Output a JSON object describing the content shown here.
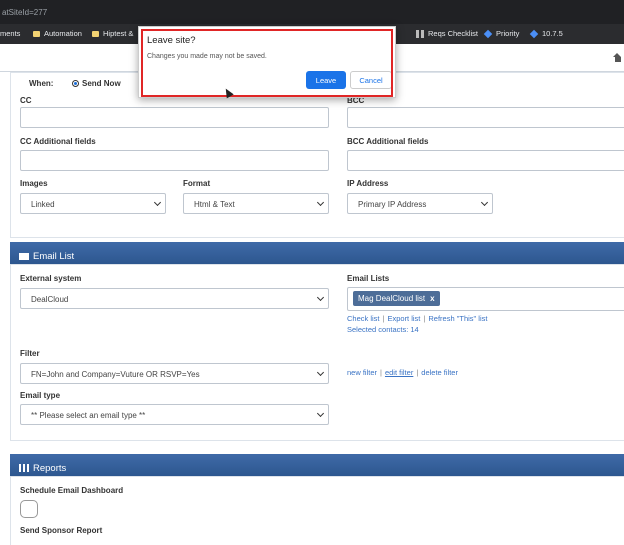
{
  "browser": {
    "url_fragment": "atSiteId=277",
    "bookmarks": [
      {
        "label": "ments",
        "icon": "none"
      },
      {
        "label": "Automation",
        "icon": "folder"
      },
      {
        "label": "Hiptest &",
        "icon": "folder"
      },
      {
        "label": "Reqs Checklist",
        "icon": "grid"
      },
      {
        "label": "Priority",
        "icon": "diamond"
      },
      {
        "label": "10.7.5",
        "icon": "diamond"
      }
    ]
  },
  "dialog": {
    "title": "Leave site?",
    "message": "Changes you made may not be saved.",
    "leave_label": "Leave",
    "cancel_label": "Cancel"
  },
  "email_form": {
    "when_label": "When:",
    "send_now_label": "Send Now",
    "cc_label": "CC",
    "bcc_label": "BCC",
    "cc_additional_label": "CC Additional fields",
    "bcc_additional_label": "BCC Additional fields",
    "images_label": "Images",
    "images_value": "Linked",
    "format_label": "Format",
    "format_value": "Html & Text",
    "ip_label": "IP Address",
    "ip_value": "Primary IP Address"
  },
  "email_list": {
    "header": "Email List",
    "external_system_label": "External system",
    "external_system_value": "DealCloud",
    "email_lists_label": "Email Lists",
    "selected_list": "Mag DealCloud list",
    "check_list": "Check list",
    "export_list": "Export list",
    "refresh_list": "Refresh \"This\" list",
    "selected_contacts": "Selected contacts: 14",
    "filter_label": "Filter",
    "filter_value": "FN=John and Company=Vuture OR RSVP=Yes",
    "new_filter": "new filter",
    "edit_filter": "edit filter",
    "delete_filter": "delete filter",
    "email_type_label": "Email type",
    "email_type_value": "** Please select an email type **"
  },
  "reports": {
    "header": "Reports",
    "schedule_label": "Schedule Email Dashboard",
    "sponsor_label": "Send Sponsor Report"
  }
}
